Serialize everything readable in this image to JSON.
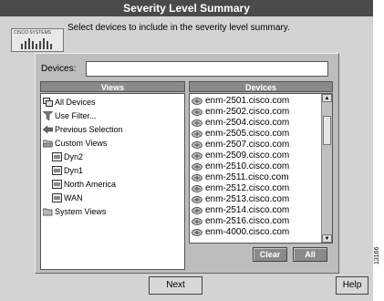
{
  "window": {
    "title": "Severity Level Summary"
  },
  "header": {
    "logo_text": "CISCO SYSTEMS",
    "instruction": "Select devices to include in the severity level summary."
  },
  "devices_field": {
    "label": "Devices:",
    "value": ""
  },
  "views": {
    "header": "Views",
    "items": [
      {
        "label": "All Devices",
        "icon": "all-devices-icon"
      },
      {
        "label": "Use Filter...",
        "icon": "filter-icon"
      },
      {
        "label": "Previous Selection",
        "icon": "back-arrow-icon"
      },
      {
        "label": "Custom Views",
        "icon": "folder-open-icon"
      },
      {
        "label": "Dyn2",
        "icon": "view-icon"
      },
      {
        "label": "Dyn1",
        "icon": "view-icon"
      },
      {
        "label": "North America",
        "icon": "view-icon"
      },
      {
        "label": "WAN",
        "icon": "view-icon"
      },
      {
        "label": "System Views",
        "icon": "folder-closed-icon"
      }
    ]
  },
  "devices": {
    "header": "Devices",
    "items": [
      "enm-2501.cisco.com",
      "enm-2502.cisco.com",
      "enm-2504.cisco.com",
      "enm-2505.cisco.com",
      "enm-2507.cisco.com",
      "enm-2509.cisco.com",
      "enm-2510.cisco.com",
      "enm-2511.cisco.com",
      "enm-2512.cisco.com",
      "enm-2513.cisco.com",
      "enm-2514.cisco.com",
      "enm-2516.cisco.com",
      "enm-4000.cisco.com"
    ]
  },
  "buttons": {
    "clear": "Clear",
    "all": "All",
    "next": "Next",
    "help": "Help"
  },
  "figure_id": "13166",
  "colors": {
    "titlebar": "#4a4a4a",
    "window_bg": "#d3d3d3",
    "panel_bg": "#bdbdbd",
    "header_bg": "#8a8a8a"
  }
}
